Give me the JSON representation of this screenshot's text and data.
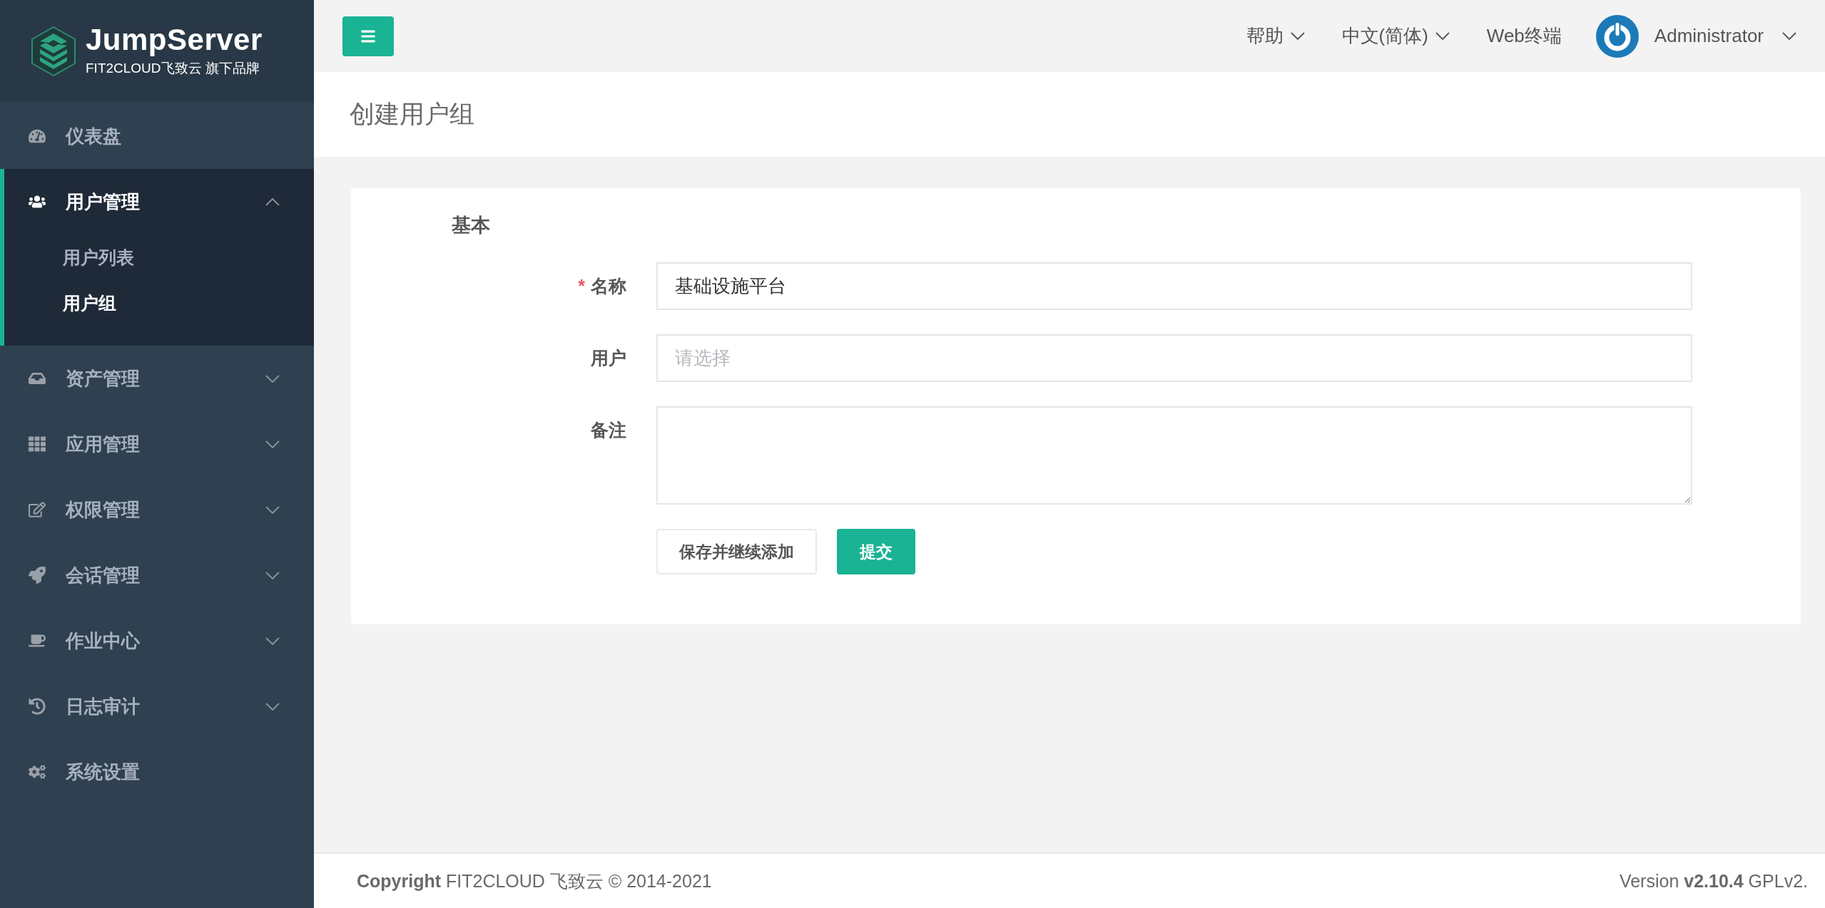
{
  "logo": {
    "name": "JumpServer",
    "tagline": "FIT2CLOUD飞致云 旗下品牌"
  },
  "sidebar": {
    "items": [
      {
        "label": "仪表盘",
        "kind": "link"
      },
      {
        "label": "用户管理",
        "kind": "group",
        "expanded": true,
        "children": [
          {
            "label": "用户列表",
            "selected": false
          },
          {
            "label": "用户组",
            "selected": true
          }
        ]
      },
      {
        "label": "资产管理",
        "kind": "group",
        "expanded": false
      },
      {
        "label": "应用管理",
        "kind": "group",
        "expanded": false
      },
      {
        "label": "权限管理",
        "kind": "group",
        "expanded": false
      },
      {
        "label": "会话管理",
        "kind": "group",
        "expanded": false
      },
      {
        "label": "作业中心",
        "kind": "group",
        "expanded": false
      },
      {
        "label": "日志审计",
        "kind": "group",
        "expanded": false
      },
      {
        "label": "系统设置",
        "kind": "link"
      }
    ]
  },
  "header": {
    "menus": [
      {
        "label": "帮助",
        "dropdown": true
      },
      {
        "label": "中文(简体)",
        "dropdown": true
      },
      {
        "label": "Web终端",
        "dropdown": false
      }
    ],
    "user": "Administrator"
  },
  "page_title": "创建用户组",
  "form": {
    "section": "基本",
    "required_mark": "*",
    "fields": [
      {
        "label": "名称",
        "kind": "input",
        "required": true,
        "value": "基础设施平台"
      },
      {
        "label": "用户",
        "kind": "select",
        "required": false,
        "placeholder": "请选择"
      },
      {
        "label": "备注",
        "kind": "textarea",
        "required": false
      }
    ],
    "buttons": [
      {
        "label": "保存并继续添加",
        "kind": "default"
      },
      {
        "label": "提交",
        "kind": "primary"
      }
    ]
  },
  "footer": {
    "copyright": "**Copyright** FIT2CLOUD 飞致云 © 2014-2021",
    "version": "Version **v2.10.4** GPLv2."
  }
}
